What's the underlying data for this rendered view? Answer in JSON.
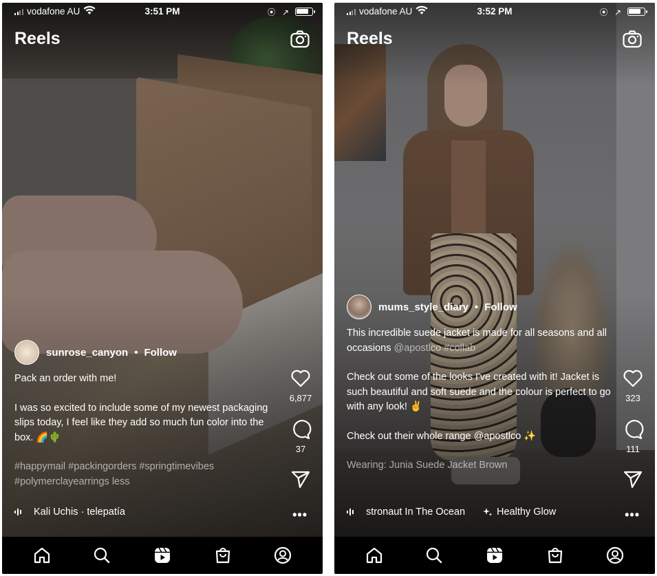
{
  "screens": [
    {
      "status": {
        "carrier": "vodafone AU",
        "time": "3:51 PM",
        "status_icons": "⦿ ↗",
        "battery_percent": 85
      },
      "header": {
        "title": "Reels",
        "camera_icon": "camera-icon"
      },
      "author": {
        "username": "sunrose_canyon",
        "separator": "•",
        "follow_label": "Follow"
      },
      "caption": {
        "line1": "Pack an order with me!",
        "line2": "I was so excited to include some of my newest packaging slips today, I feel like they add so much fun color into the box. 🌈🌵",
        "hashtags": "#happymail #packingorders #springtimevibes #polymerclayearrings less"
      },
      "actions": {
        "likes": "6,877",
        "comments": "37"
      },
      "audio": {
        "text": "Kali Uchis · telepatía"
      },
      "more_label": "•••"
    },
    {
      "status": {
        "carrier": "vodafone AU",
        "time": "3:52 PM",
        "status_icons": "⦿ ↗",
        "battery_percent": 85
      },
      "header": {
        "title": "Reels",
        "camera_icon": "camera-icon"
      },
      "author": {
        "username": "mums_style_diary",
        "separator": "•",
        "follow_label": "Follow"
      },
      "caption": {
        "line1_text": "This incredible suede jacket is made for all seasons and all occasions",
        "line1_mention": "@apostlco #collab",
        "line2": "Check out some of the looks I've created with it! Jacket is such beautiful and soft suede and the colour is perfect to go with any look! ✌️",
        "line3_text": "Check out their whole range @apostlco",
        "line3_emoji": "✨",
        "wearing": "Wearing: Junia Suede Jacket Brown"
      },
      "actions": {
        "likes": "323",
        "comments": "111"
      },
      "audio": {
        "text": "stronaut In The Ocean",
        "effect": "Healthy Glow"
      },
      "more_label": "•••"
    }
  ],
  "tabbar": [
    "home-icon",
    "search-icon",
    "reels-icon",
    "shop-icon",
    "profile-icon"
  ],
  "colors": {
    "text": "#ffffff",
    "tabbar_bg": "#000000",
    "muted_text": "#a8a8a8"
  }
}
